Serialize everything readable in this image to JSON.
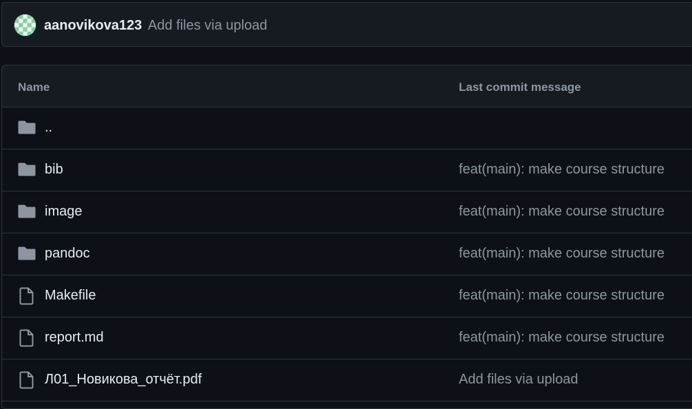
{
  "commit": {
    "user": "aanovikova123",
    "message": "Add files via upload",
    "avatar_icon": "identicon-avatar"
  },
  "table": {
    "headers": {
      "name": "Name",
      "last_commit_message": "Last commit message"
    },
    "rows": [
      {
        "type": "folder",
        "icon": "folder-icon",
        "name": "..",
        "message": ""
      },
      {
        "type": "folder",
        "icon": "folder-icon",
        "name": "bib",
        "message": "feat(main): make course structure"
      },
      {
        "type": "folder",
        "icon": "folder-icon",
        "name": "image",
        "message": "feat(main): make course structure"
      },
      {
        "type": "folder",
        "icon": "folder-icon",
        "name": "pandoc",
        "message": "feat(main): make course structure"
      },
      {
        "type": "file",
        "icon": "file-icon",
        "name": "Makefile",
        "message": "feat(main): make course structure"
      },
      {
        "type": "file",
        "icon": "file-icon",
        "name": "report.md",
        "message": "feat(main): make course structure"
      },
      {
        "type": "file",
        "icon": "file-icon",
        "name": "Л01_Новикова_отчёт.pdf",
        "message": "Add files via upload"
      }
    ]
  },
  "colors": {
    "background": "#0d1117",
    "header_bg": "#161b22",
    "border": "#30363d",
    "text_primary": "#e6edf3",
    "text_muted": "#8d96a0",
    "icon": "#8d96a0"
  }
}
